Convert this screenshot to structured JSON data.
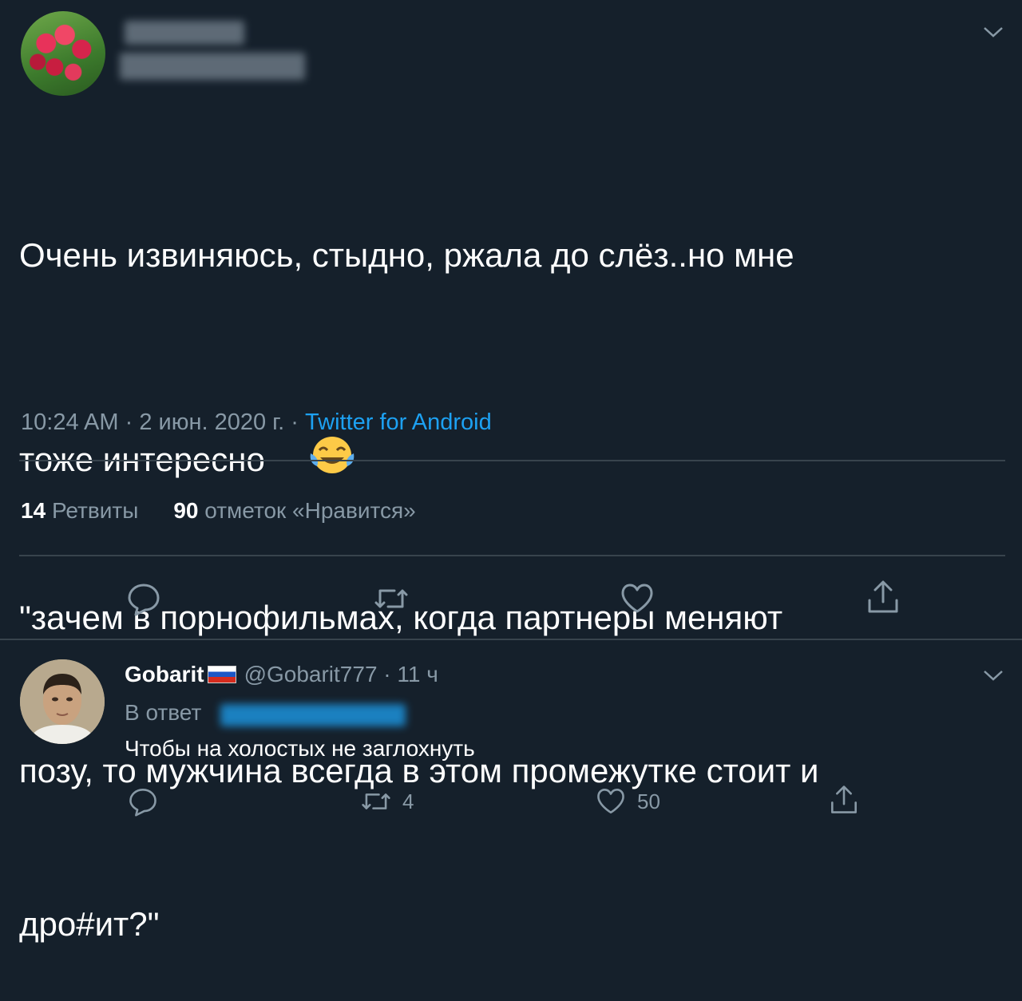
{
  "tweet": {
    "text_line1": "Очень извиняюсь, стыдно, ржала до слёз..но мне",
    "text_line2": "тоже интересно",
    "text_line3": "\"зачем в порнофильмах, когда партнеры меняют",
    "text_line4": "позу, то мужчина всегда в этом промежутке стоит и",
    "text_line5": "дро#ит?\"",
    "emoji": "face-with-tears-of-joy-icon",
    "time": "10:24 AM",
    "separator": " · ",
    "date": "2 июн. 2020 г.",
    "source": "Twitter for Android",
    "retweets_count": "14",
    "retweets_label": "Ретвиты",
    "likes_count": "90",
    "likes_label": "отметок «Нравится»"
  },
  "reply": {
    "name": "Gobarit",
    "handle": "@Gobarit777",
    "time_separator": " · ",
    "time": "11 ч",
    "reply_to_label": "В ответ",
    "text": "Чтобы на холостых не заглохнуть",
    "retweets": "4",
    "likes": "50"
  },
  "colors": {
    "background": "#15202b",
    "secondary_text": "#8899a6",
    "link": "#1da1f2",
    "divider": "#38444d"
  }
}
